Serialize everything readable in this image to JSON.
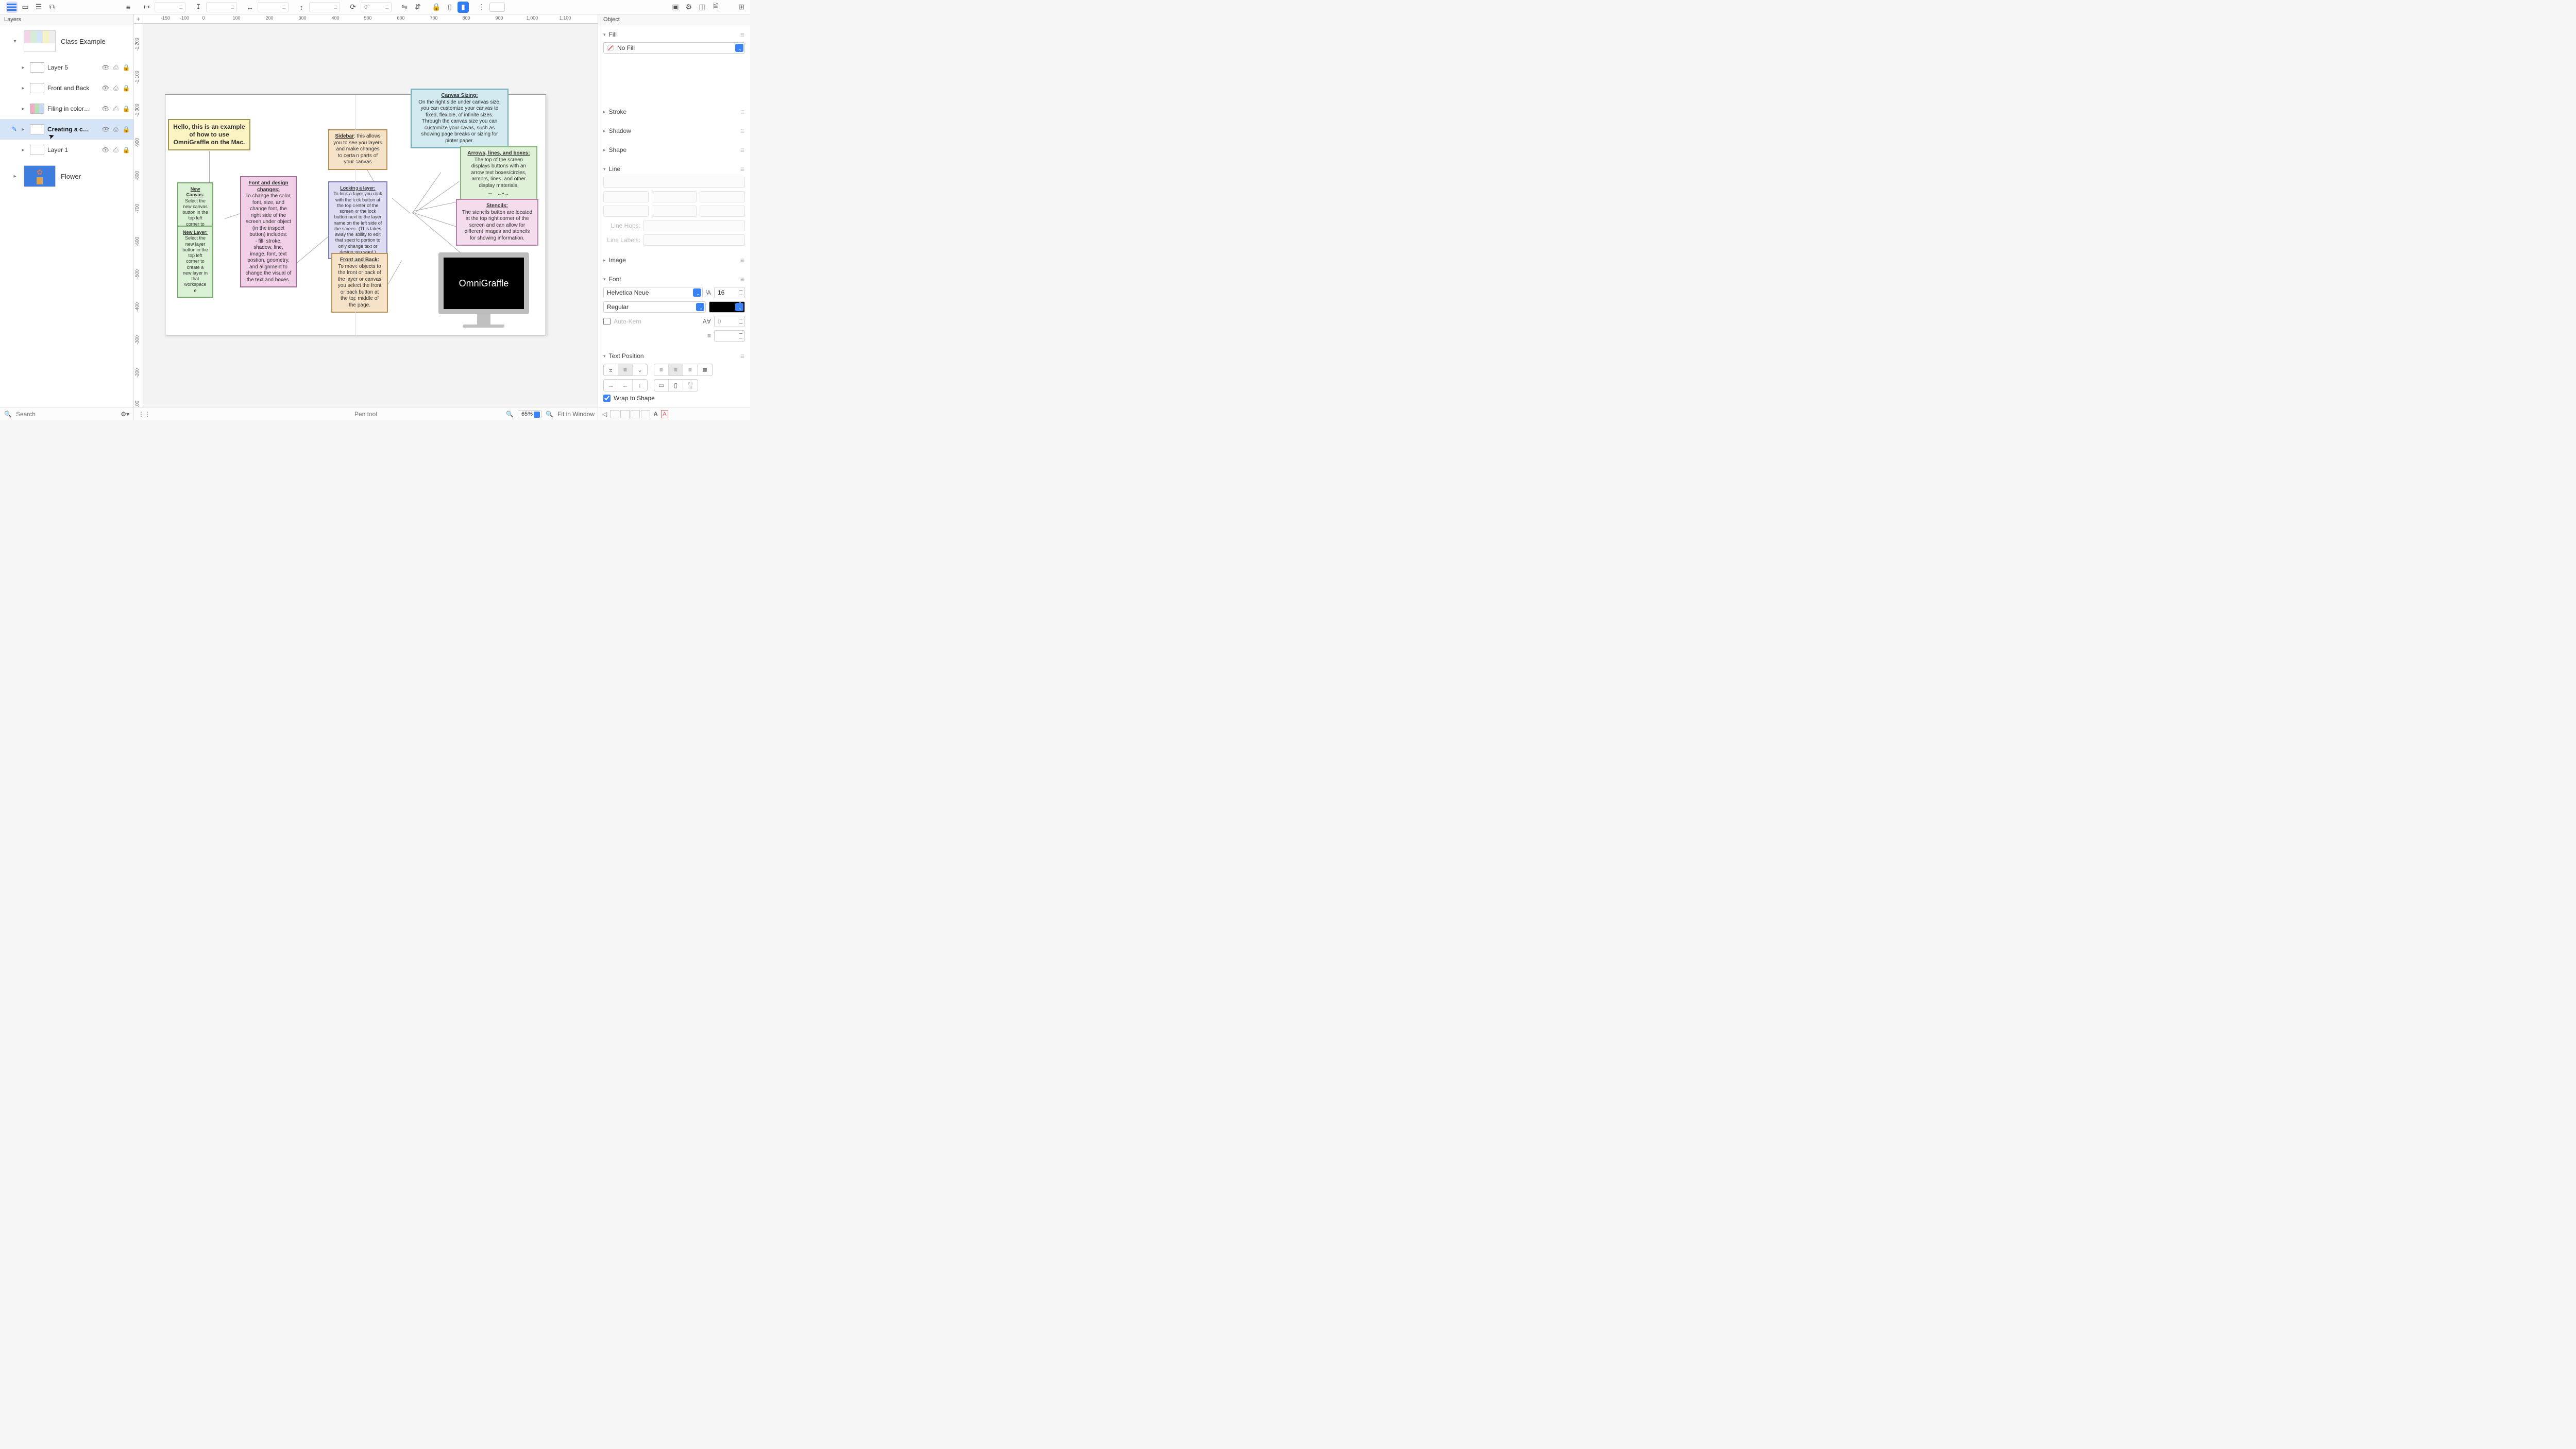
{
  "toolbar": {
    "rotation": "0°"
  },
  "sidebar": {
    "title": "Layers",
    "canvases": [
      {
        "name": "Class Example",
        "expanded": true
      },
      {
        "name": "Flower",
        "expanded": false
      }
    ],
    "layers": [
      {
        "name": "Layer 5"
      },
      {
        "name": "Front and Back"
      },
      {
        "name": "Filing in color…"
      },
      {
        "name": "Creating a c…",
        "selected": true,
        "active": true
      },
      {
        "name": "Layer 1"
      }
    ],
    "search_placeholder": "Search"
  },
  "ruler_h": [
    "-150",
    "-100",
    "0",
    "100",
    "200",
    "300",
    "400",
    "500",
    "600",
    "700",
    "800",
    "900",
    "1,000",
    "1,100"
  ],
  "ruler_v": [
    "-1,200",
    "-1,100",
    "-1,000",
    "-900",
    "-800",
    "-700",
    "-600",
    "-500",
    "-400",
    "-300",
    "-200",
    "-100"
  ],
  "nodes": {
    "hello": "Hello, this is an example of how to use OmniGraffle on the Mac.",
    "sidebar_hd": "Sidebar",
    "sidebar_body": ": this allows you to see you layers and make changes to certain parts of your canvas",
    "canvas_sizing_hd": "Canvas Sizing:",
    "canvas_sizing_body": "On the right side under canvas size, you can customize your canvas to fixed, flexible, of infinite sizes. Through the canvas size you can customize your cavas, such as showing page breaks or sizing for pinter paper.",
    "arrows_hd": "Arrows, lines, and boxes:",
    "arrows_body": "The top of the screen displays buttons with an arrow text boxes/circles, armors, lines, and other display materials.",
    "stencils_hd": "Stencils:",
    "stencils_body": "The stencils button are located at the top right corner of the screen and can allow for different images and stencils for showing information.",
    "font_hd": "Font and design changes:",
    "font_body": "To change the color, font, size, and change font, the right side of the screen under object (in the inspect button) includes:\n- fill, stroke, shadow, line, image, font, text postion, geometry, and alignment to change the visual of the text and boxes.",
    "locking_hd": "Locking a layer:",
    "locking_body": "To lock a layer you click with the lock button at the top center of the screen or the lock button next to the layer name on the left side of the screen. (This takes away the ability to edit that specific portion to only change text or design you want.)",
    "frontback_hd": "Front and Back:",
    "frontback_body": "To move objects to the front or back of the layer or canvas you select the front or back button at the top middle of the page.",
    "newcanvas_hd": "New Canvas:",
    "newcanvas_body": "Select the new canvas button in the top left corner to create a new canvas for your workspace",
    "newlayer_hd": "New Layer:",
    "newlayer_body": "Select the new layer button in the top left corner to create a new layer in that workspace e",
    "monitor": "OmniGraffle"
  },
  "inspector": {
    "title": "Object",
    "sections": {
      "fill": "Fill",
      "fill_value": "No Fill",
      "stroke": "Stroke",
      "shadow": "Shadow",
      "shape": "Shape",
      "line": "Line",
      "line_hops": "Line Hops:",
      "line_labels": "Line Labels:",
      "image": "Image",
      "font": "Font",
      "font_family": "Helvetica Neue",
      "font_size": "16",
      "font_weight": "Regular",
      "auto_kern": "Auto-Kern",
      "kern_val": "0",
      "text_position": "Text Position",
      "wrap": "Wrap to Shape"
    }
  },
  "footer": {
    "status": "Pen tool",
    "zoom": "65%",
    "fit": "Fit in Window"
  }
}
